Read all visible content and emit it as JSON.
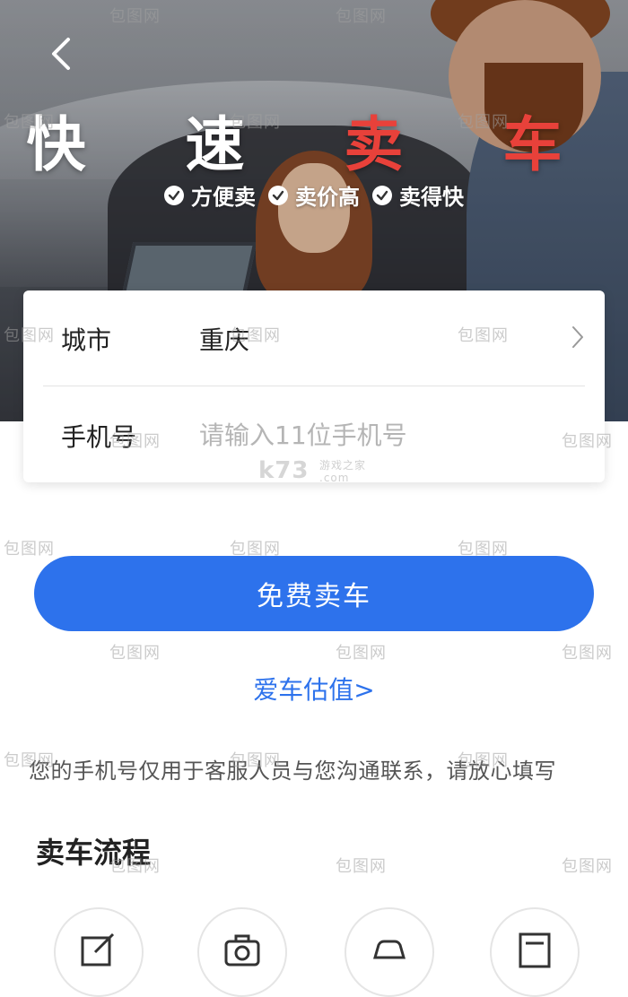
{
  "hero": {
    "title_part1": "快 速",
    "title_part2": "卖 车",
    "features": [
      "方便卖",
      "卖价高",
      "卖得快"
    ]
  },
  "form": {
    "city_label": "城市",
    "city_value": "重庆",
    "phone_label": "手机号",
    "phone_placeholder": "请输入11位手机号",
    "phone_value": ""
  },
  "submit_label": "免费卖车",
  "valuation_link": "爱车估值>",
  "notice": "您的手机号仅用于客服人员与您沟通联系，请放心填写",
  "section_title": "卖车流程",
  "steps_icons": [
    "edit-icon",
    "camera-icon",
    "car-icon",
    "document-icon"
  ],
  "watermarks": {
    "site": "包图网",
    "k73": "k73",
    "k73_sub": "游戏之家",
    "k73_com": ".com"
  },
  "colors": {
    "accent": "#2d72ec",
    "title_red": "#e8413a"
  }
}
